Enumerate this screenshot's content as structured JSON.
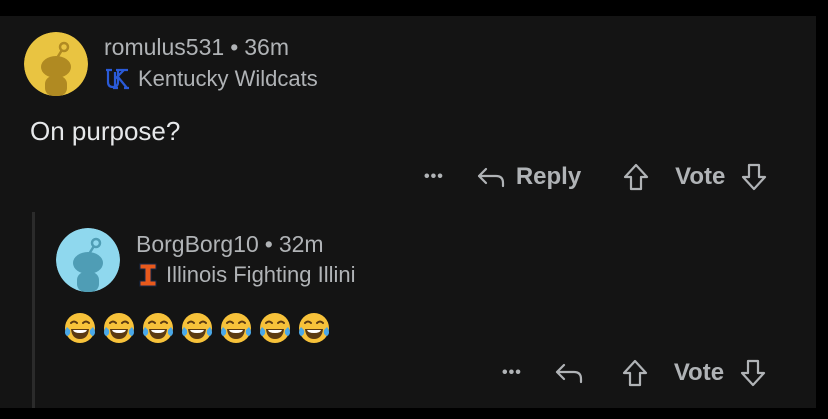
{
  "comments": [
    {
      "username": "romulus531",
      "separator": "•",
      "age": "36m",
      "flair_text": "Kentucky Wildcats",
      "flair_icon": "kentucky-uk-logo-icon",
      "body": "On purpose?",
      "actions": {
        "more": "•••",
        "reply": "Reply",
        "vote": "Vote"
      },
      "avatar_color": "#e9c441"
    },
    {
      "username": "BorgBorg10",
      "separator": "•",
      "age": "32m",
      "flair_text": "Illinois Fighting Illini",
      "flair_icon": "illinois-block-i-logo-icon",
      "body_emojis": [
        "😂",
        "😂",
        "😂",
        "😂",
        "😂",
        "😂",
        "😂"
      ],
      "actions": {
        "more": "•••",
        "vote": "Vote"
      },
      "avatar_color": "#8fd8ee"
    }
  ],
  "colors": {
    "background": "#141414",
    "text_muted": "#b0b3b6",
    "kentucky_blue": "#2a5ad7",
    "illinois_orange": "#e8591c"
  }
}
